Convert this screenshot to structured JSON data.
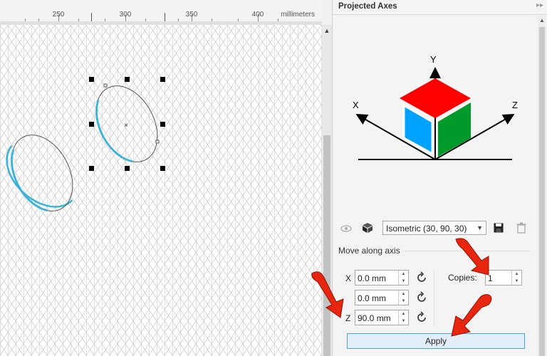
{
  "ruler": {
    "labels": [
      "250",
      "300",
      "350",
      "400"
    ],
    "unit": "millimeters"
  },
  "docker": {
    "title": "Projected Axes",
    "collapse_icon": "double-chevron-right-icon",
    "diagram": {
      "y_label": "Y",
      "x_label": "X",
      "z_label": "Z",
      "colors": {
        "top": "#ff0000",
        "left": "#00a2ff",
        "right": "#009a2b"
      }
    },
    "preset": {
      "value": "Isometric (30, 90, 30)"
    },
    "move_section": {
      "label": "Move along axis"
    },
    "fields": [
      {
        "axis": "X",
        "value": "0.0 mm"
      },
      {
        "axis": "",
        "value": "0.0 mm"
      },
      {
        "axis": "Z",
        "value": "90.0 mm"
      }
    ],
    "copies": {
      "label": "Copies:",
      "value": "1"
    },
    "apply_label": "Apply"
  },
  "colors": {
    "selection_stroke": "#3bb3d6",
    "arrow_red": "#e8250e",
    "grid": "#c8c8c8"
  }
}
